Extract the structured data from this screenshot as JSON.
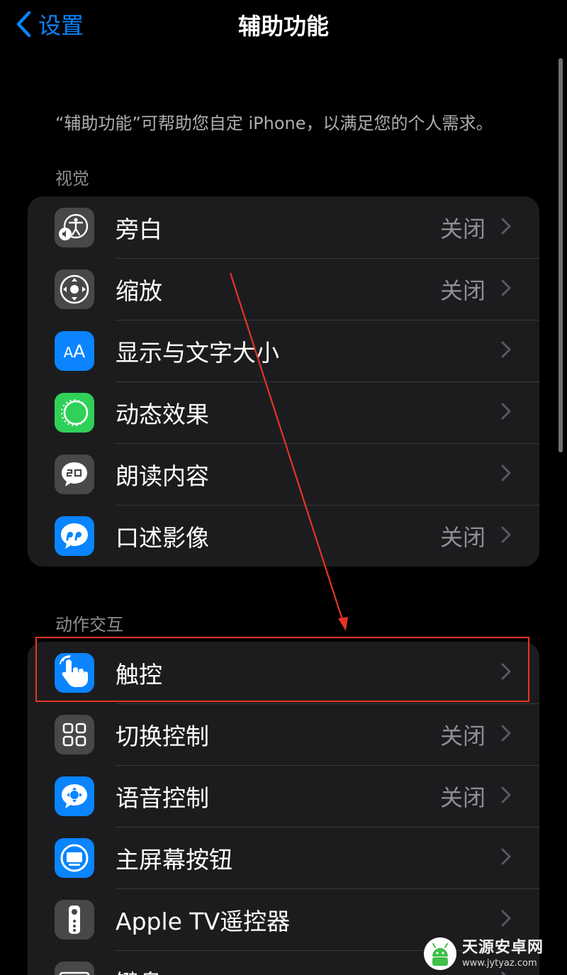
{
  "nav": {
    "back_label": "设置",
    "title": "辅助功能"
  },
  "intro_text": "“辅助功能”可帮助您自定 iPhone，以满足您的个人需求。",
  "sections": [
    {
      "header": "视觉",
      "rows": [
        {
          "label": "旁白",
          "value": "关闭",
          "icon": "voiceover-icon",
          "icon_color": "gray"
        },
        {
          "label": "缩放",
          "value": "关闭",
          "icon": "zoom-icon",
          "icon_color": "gray"
        },
        {
          "label": "显示与文字大小",
          "value": "",
          "icon": "text-size-icon",
          "icon_color": "blue"
        },
        {
          "label": "动态效果",
          "value": "",
          "icon": "motion-icon",
          "icon_color": "green"
        },
        {
          "label": "朗读内容",
          "value": "",
          "icon": "spoken-content-icon",
          "icon_color": "gray"
        },
        {
          "label": "口述影像",
          "value": "关闭",
          "icon": "audio-descriptions-icon",
          "icon_color": "blue"
        }
      ]
    },
    {
      "header": "动作交互",
      "rows": [
        {
          "label": "触控",
          "value": "",
          "icon": "touch-icon",
          "icon_color": "blue"
        },
        {
          "label": "切换控制",
          "value": "关闭",
          "icon": "switch-control-icon",
          "icon_color": "gray"
        },
        {
          "label": "语音控制",
          "value": "关闭",
          "icon": "voice-control-icon",
          "icon_color": "blue"
        },
        {
          "label": "主屏幕按钮",
          "value": "",
          "icon": "home-button-icon",
          "icon_color": "blue"
        },
        {
          "label": "Apple TV遥控器",
          "value": "",
          "icon": "apple-tv-remote-icon",
          "icon_color": "gray"
        },
        {
          "label": "键盘",
          "value": "",
          "icon": "keyboard-icon",
          "icon_color": "gray"
        }
      ]
    }
  ],
  "colors": {
    "accent": "#0a84ff",
    "background": "#000000",
    "cell": "#1c1c1e",
    "annotation": "#e53424"
  },
  "watermark": {
    "main": "天源安卓网",
    "sub": "www.jytyaz.com"
  }
}
